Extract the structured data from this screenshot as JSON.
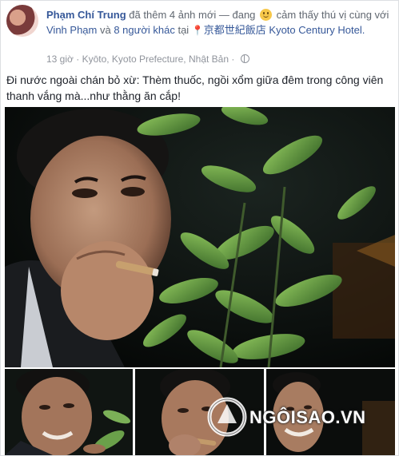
{
  "post": {
    "author": "Phạm Chí Trung",
    "headline_added": "đã thêm 4 ảnh mới — đang",
    "feeling": "cảm thấy thú vị",
    "with_prefix": "cùng với",
    "tagged_person": "Vinh Phạm",
    "and_text": "và",
    "others": "8 người khác",
    "at_text": "tại",
    "place": "京都世紀飯店 Kyoto Century Hotel.",
    "time": "13 giờ",
    "location": "Kyōto, Kyoto Prefecture, Nhật Bản",
    "separator": "·",
    "text": "Đi nước ngoài chán bỏ xừ: Thèm thuốc, ngồi xổm giữa đêm trong công viên thanh vắng mà...như thằng ăn cắp!"
  },
  "watermark": {
    "text": "NGÔISAO.VN"
  },
  "icons": {
    "feeling": "smiley-icon",
    "place": "map-pin-icon",
    "privacy": "globe-icon"
  },
  "colors": {
    "link": "#365899",
    "meta": "#90949c",
    "text": "#1d2129"
  }
}
